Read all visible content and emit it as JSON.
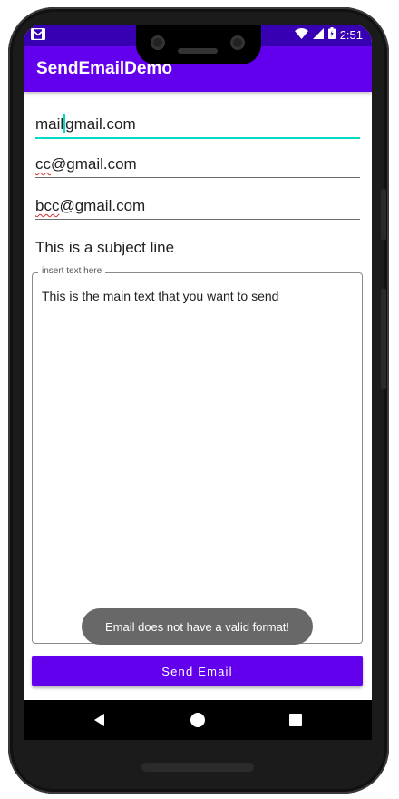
{
  "status_bar": {
    "time": "2:51",
    "left_icon": "gmail-notification-icon",
    "right_icons": [
      "wifi-icon",
      "cellular-signal-icon",
      "battery-icon"
    ]
  },
  "app": {
    "title": "SendEmailDemo"
  },
  "form": {
    "to_value_before_cursor": "mail",
    "to_value_after_cursor": "gmail.com",
    "cc_value_underlined": "cc",
    "cc_value_rest": "@gmail.com",
    "bcc_value_underlined": "bcc",
    "bcc_value_rest": "@gmail.com",
    "subject_value": "This is a subject line",
    "body_label": "insert text here",
    "body_value": "This is the main text that you want to send"
  },
  "toast": {
    "message": "Email does not have a valid format!"
  },
  "send_button": {
    "label": "Send Email"
  },
  "nav_bar": {
    "buttons": [
      "back-icon",
      "home-icon",
      "recents-icon"
    ]
  },
  "colors": {
    "primary": "#6200ee",
    "primary_dark": "#3700b3",
    "accent": "#03dac5",
    "toast_bg": "#686868"
  }
}
